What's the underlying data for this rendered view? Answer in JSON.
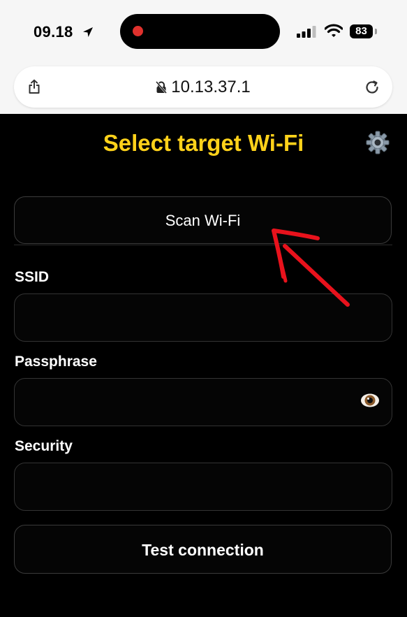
{
  "status_bar": {
    "time": "09.18",
    "battery": "83"
  },
  "browser": {
    "url": "10.13.37.1"
  },
  "page": {
    "title": "Select target Wi-Fi",
    "scan_button": "Scan Wi-Fi",
    "ssid_label": "SSID",
    "passphrase_label": "Passphrase",
    "security_label": "Security",
    "test_button": "Test connection"
  },
  "colors": {
    "title": "#ffd21a",
    "background": "#000000",
    "annotation": "#e8121c"
  },
  "icons": [
    "location-arrow-icon",
    "signal-icon",
    "wifi-icon",
    "battery-icon",
    "share-icon",
    "lock-slash-icon",
    "reload-icon",
    "gear-icon",
    "eye-icon"
  ]
}
